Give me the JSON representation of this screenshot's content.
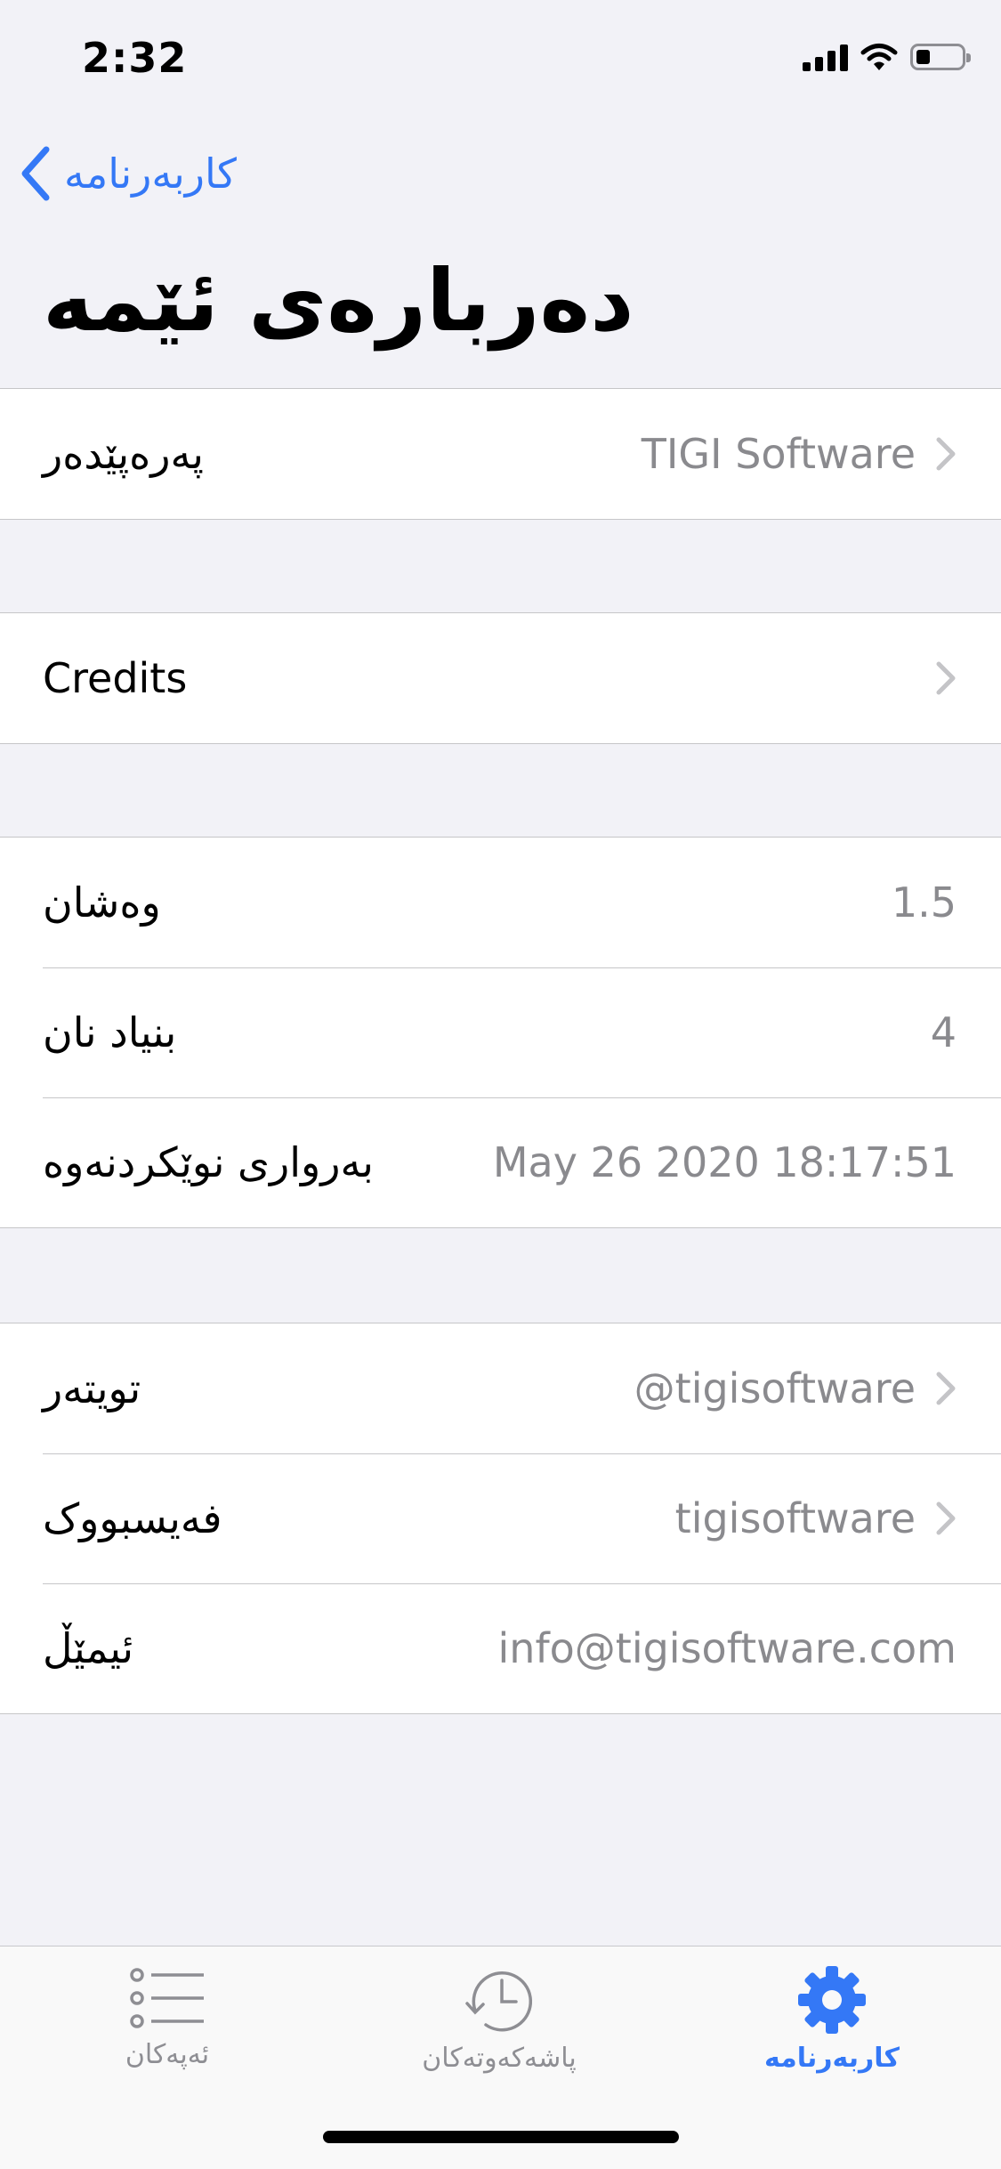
{
  "status": {
    "time": "2:32"
  },
  "nav": {
    "back_label": "کاربەرنامە",
    "title": "دەربارەی ئێمە"
  },
  "sections": {
    "developer": {
      "label": "پەرەپێدەر",
      "value": "TIGI Software"
    },
    "credits": {
      "label": "Credits"
    },
    "version": {
      "label": "وەشان",
      "value": "1.5"
    },
    "build": {
      "label": "بنیاد نان",
      "value": "4"
    },
    "update_date": {
      "label": "بەرواری نوێکردنەوە",
      "value": "May 26 2020 18:17:51"
    },
    "twitter": {
      "label": "تویتەر",
      "value": "@tigisoftware"
    },
    "facebook": {
      "label": "فەیسبووک",
      "value": "tigisoftware"
    },
    "email": {
      "label": "ئیمێڵ",
      "value": "info@tigisoftware.com"
    }
  },
  "tabbar": {
    "tabs": [
      {
        "label": "ئەپەکان",
        "icon": "list-icon",
        "active": false
      },
      {
        "label": "پاشەکەوتەکان",
        "icon": "history-icon",
        "active": false
      },
      {
        "label": "کاربەرنامە",
        "icon": "gear-icon",
        "active": true
      }
    ]
  },
  "colors": {
    "accent": "#3478f6",
    "secondary_text": "#8a8a8e",
    "background": "#f2f2f7"
  }
}
